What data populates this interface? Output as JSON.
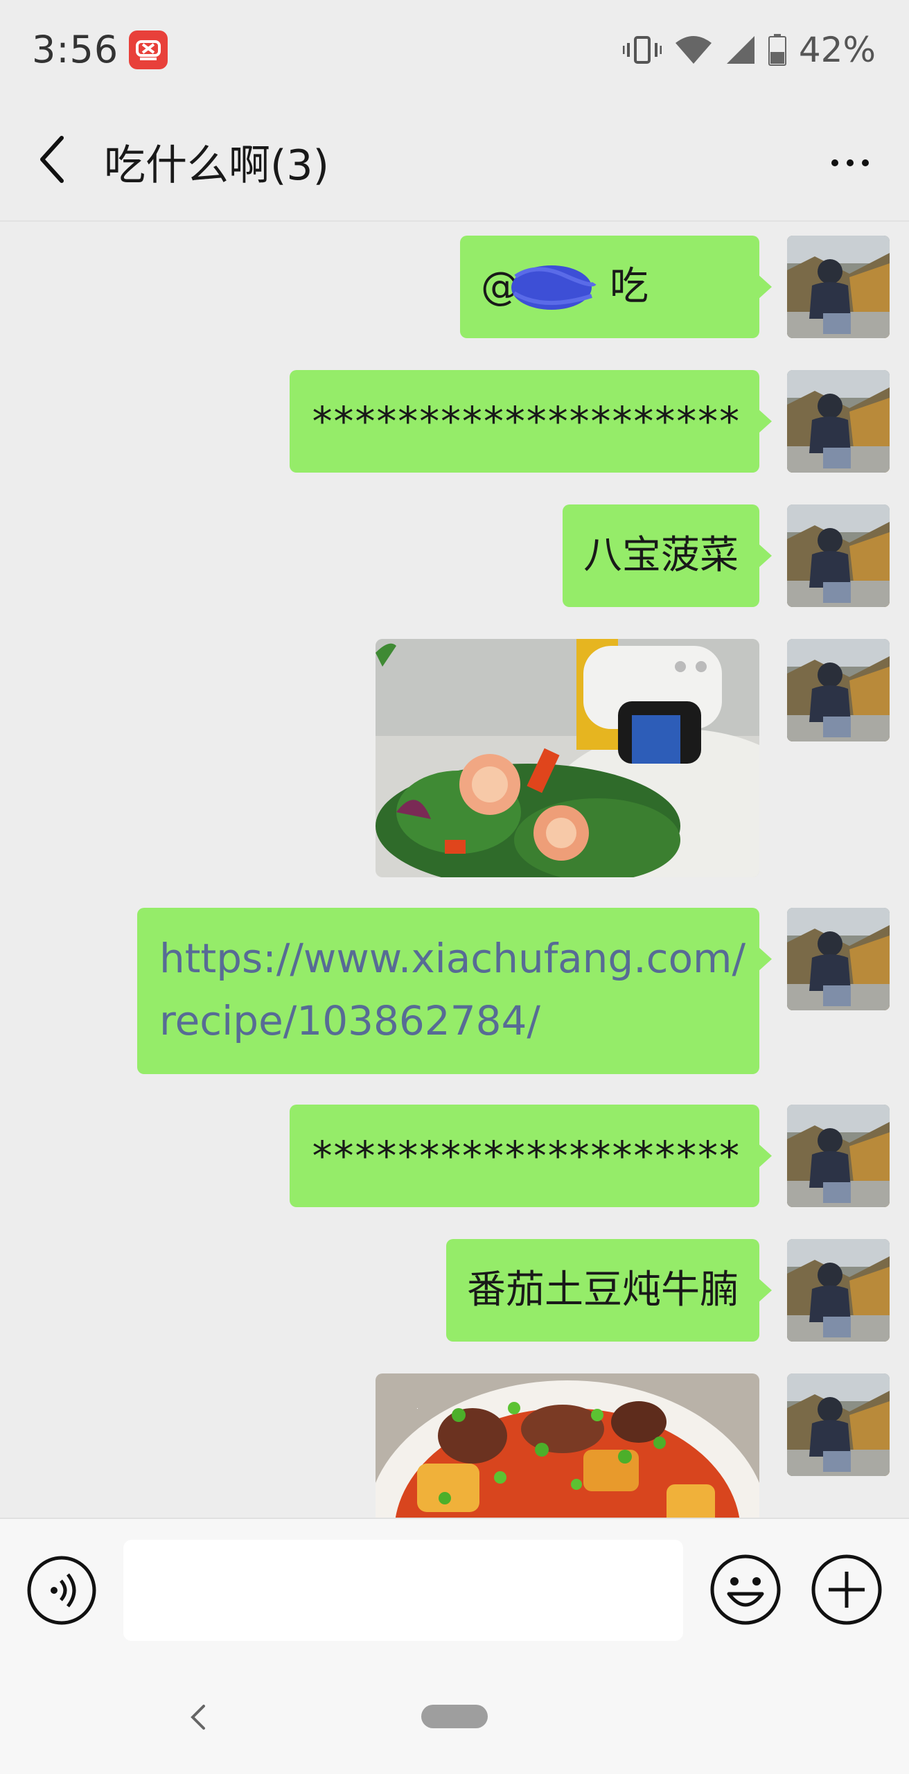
{
  "status": {
    "time": "3:56",
    "battery": "42%",
    "icons": [
      "vibrate-icon",
      "wifi-icon",
      "signal-icon",
      "battery-icon"
    ],
    "app_icon": "xiachufang-app-icon"
  },
  "header": {
    "title": "吃什么啊(3)",
    "back_icon": "back-arrow-icon",
    "more_icon": "more-icon"
  },
  "messages": [
    {
      "type": "text",
      "text": "@吃"
    },
    {
      "type": "text",
      "text": "********************"
    },
    {
      "type": "text",
      "text": "八宝菠菜"
    },
    {
      "type": "image",
      "description_icon": "shrimp-dish-image"
    },
    {
      "type": "link",
      "text": "https://www.xiachufang.com/recipe/103862784/",
      "line1": "https://www.xiachufang.com/",
      "line2": "recipe/103862784/"
    },
    {
      "type": "text",
      "text": "********************"
    },
    {
      "type": "text",
      "text": "番茄土豆炖牛腩"
    },
    {
      "type": "image",
      "description_icon": "beef-stew-image"
    }
  ],
  "input": {
    "value": "",
    "placeholder": ""
  },
  "colors": {
    "background": "#ededed",
    "bubble": "#95ec69",
    "link": "#576b95",
    "app_icon": "#e8403a"
  }
}
